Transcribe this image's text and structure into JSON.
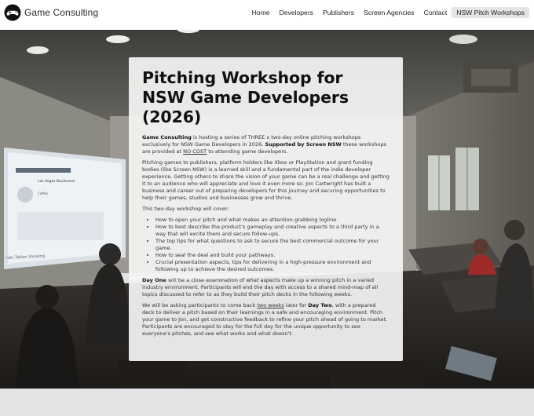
{
  "header": {
    "brand": "Game Consulting",
    "nav": [
      {
        "label": "Home",
        "active": false
      },
      {
        "label": "Developers",
        "active": false
      },
      {
        "label": "Publishers",
        "active": false
      },
      {
        "label": "Screen Agencies",
        "active": false
      },
      {
        "label": "Contact",
        "active": false
      },
      {
        "label": "NSW Pitch Workshops",
        "active": true
      }
    ]
  },
  "hero": {
    "screen_text": {
      "title": "Las Vegas Boulevard",
      "sub": "Coffee",
      "bottom": "ndo Tables Showing"
    }
  },
  "card": {
    "title": "Pitching Workshop for NSW Game Developers (2026)",
    "intro": {
      "b1": "Game Consulting",
      "t1": " is hosting a series of THREE x two-day online pitching workshops exclusively for NSW Game Developers in 2026. ",
      "b2": "Supported by Screen NSW",
      "t2": " these workshops are provided at ",
      "u1": "NO COST",
      "t3": " to attending game developers."
    },
    "para2": "Pitching games to publishers, platform holders like Xbox or PlayStation and grant funding bodies (like Screen NSW) is a learned skill and a fundamental part of the indie developer experience. Getting others to share the vision of your game can be a real challenge and getting it to an audience who will appreciate and love it even more so. Jon Cartwright has built a business and career out of preparing developers for this journey and securing opportunities to help their games, studios and businesses grow and thrive.",
    "cover_intro": "This two-day workshop will cover:",
    "cover_items": [
      "How to open your pitch and what makes an attention-grabbing logline.",
      "How to best describe the product's gameplay and creative aspects to a third party in a way that will excite them and secure follow-ups.",
      "The top tips for what questions to ask to secure the best commercial outcome for your game.",
      "How to seal the deal and build your pathways.",
      "Crucial presentation aspects, tips for delivering in a high-pressure environment and following up to achieve the desired outcomes."
    ],
    "day_one": {
      "b": "Day One",
      "t": " will be a close examination of what aspects make up a winning pitch in a varied industry environment. Participants will end the day with access to a shared mind-map of all topics discussed to refer to as they build their pitch decks in the following weeks."
    },
    "day_two": {
      "t1": "We will be asking participants to come back ",
      "u": "two weeks",
      "t2": " later for ",
      "b": "Day Two",
      "t3": ", with a prepared deck to deliver a pitch based on their learnings in a safe and encouraging environment. Pitch your game to Jon, and get constructive feedback to refine your pitch ahead of going to market. Participants are encouraged to stay for the full day for the unique opportunity to see everyone's pitches, and see what works and what doesn't."
    }
  }
}
